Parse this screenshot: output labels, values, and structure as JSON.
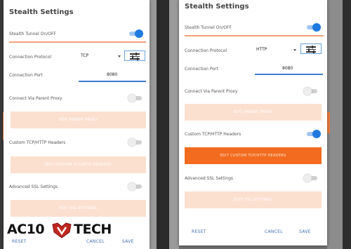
{
  "left_dialog": {
    "title": "Stealth Settings",
    "stealth_tunnel_label": "Stealth Tunnel On/OFF",
    "connection_protocol_label": "Connection Protocol",
    "connection_protocol_value": "TCP",
    "connection_port_label": "Connection Port",
    "connection_port_value": "8080",
    "parent_proxy_label": "Connect Via Parent Proxy",
    "edit_parent_proxy": "EDIT PARENT PROXY",
    "custom_headers_label": "Custom TCP/HTTP Headers",
    "edit_custom_headers": "EDIT CUSTOM TCP/HTTP HEADERS",
    "advanced_ssl_label": "Advanced SSL Settings",
    "edit_ssl_settings": "EDIT SSL SETTINGS",
    "reset": "RESET",
    "cancel": "CANCEL",
    "save": "SAVE",
    "stealth_tunnel_on": true,
    "parent_proxy_on": false,
    "custom_headers_on": false,
    "advanced_ssl_on": false
  },
  "right_dialog": {
    "title": "Stealth Settings",
    "stealth_tunnel_label": "Stealth Tunnel On/OFF",
    "connection_protocol_label": "Connection Protocol",
    "connection_protocol_value": "HTTP",
    "connection_port_label": "Connection Port",
    "connection_port_value": "8080",
    "parent_proxy_label": "Connect Via Parent Proxy",
    "edit_parent_proxy": "EDIT PARENT PROXY",
    "custom_headers_label": "Custom TCP/HTTP Headers",
    "edit_custom_headers": "EDIT CUSTOM TCP/HTTP HEADERS",
    "advanced_ssl_label": "Advanced SSL Settings",
    "edit_ssl_settings": "EDIT SSL SETTINGS",
    "reset": "RESET",
    "cancel": "CANCEL",
    "save": "SAVE",
    "stealth_tunnel_on": true,
    "parent_proxy_on": false,
    "custom_headers_on": true,
    "advanced_ssl_on": false
  },
  "watermark": {
    "text_left": "AC10",
    "text_right": "TECH"
  },
  "colors": {
    "accent": "#f26b1f",
    "accent_light": "#fbe0d0",
    "toggle_on": "#1f7ae0",
    "link": "#3d6fb8"
  }
}
